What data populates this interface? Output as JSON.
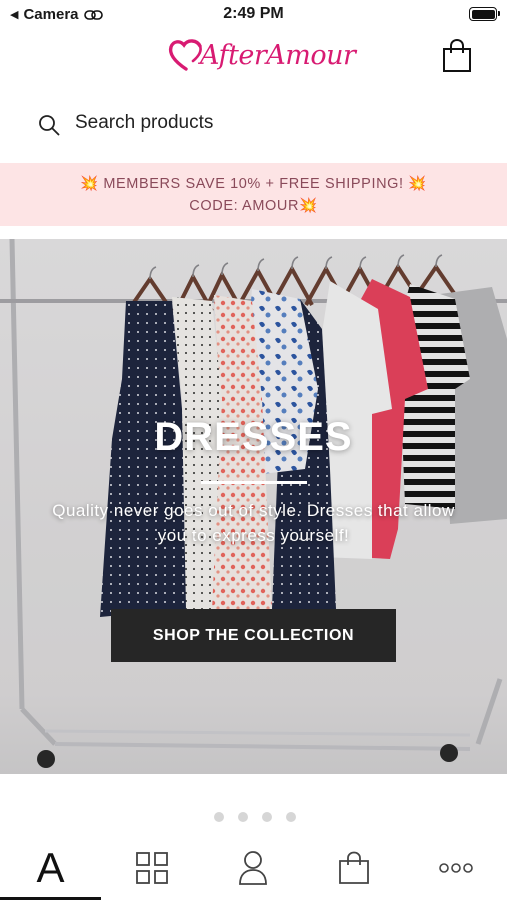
{
  "status_bar": {
    "back_app": "Camera",
    "time": "2:49 PM"
  },
  "header": {
    "logo_text": "AfterAmour"
  },
  "search": {
    "placeholder": "Search products"
  },
  "promo": {
    "line1": "💥 MEMBERS SAVE 10% + FREE SHIPPING! 💥",
    "line2": "CODE: AMOUR💥"
  },
  "hero": {
    "title": "DRESSES",
    "subtitle": "Quality never goes out of style. Dresses that allow you to express yourself!",
    "cta_label": "SHOP THE COLLECTION"
  },
  "carousel": {
    "slide_count": 4,
    "active_index": 0
  },
  "tabbar": {
    "tabs": [
      {
        "label": "A",
        "icon": "home-logo-icon",
        "active": true
      },
      {
        "icon": "grid-icon"
      },
      {
        "icon": "user-icon"
      },
      {
        "icon": "bag-icon"
      },
      {
        "icon": "more-icon"
      }
    ]
  },
  "colors": {
    "brand_pink": "#d81b72",
    "promo_bg": "#fde4e5",
    "promo_text": "#8a4a5a",
    "cta_bg": "#262626"
  }
}
